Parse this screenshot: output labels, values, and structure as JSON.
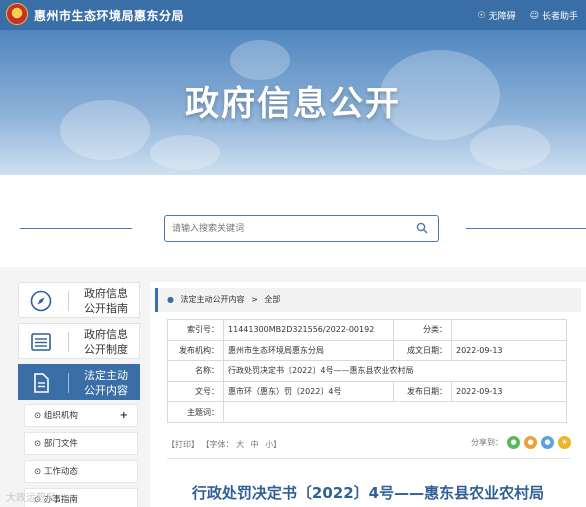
{
  "header": {
    "site_title": "惠州市生态环境局惠东分局",
    "links": [
      {
        "label": "无障碍",
        "icon": "accessibility-icon"
      },
      {
        "label": "长者助手",
        "icon": "elder-assist-icon"
      }
    ]
  },
  "banner": {
    "title": "政府信息公开"
  },
  "search": {
    "placeholder": "请输入搜索关键词"
  },
  "sidebar": {
    "items": [
      {
        "label_line1": "政府信息",
        "label_line2": "公开指南",
        "icon": "compass-icon",
        "active": false
      },
      {
        "label_line1": "政府信息",
        "label_line2": "公开制度",
        "icon": "list-icon",
        "active": false
      },
      {
        "label_line1": "法定主动",
        "label_line2": "公开内容",
        "icon": "document-icon",
        "active": true
      }
    ],
    "subitems": [
      {
        "label": "组织机构",
        "expandable": true,
        "expand_symbol": "+"
      },
      {
        "label": "部门文件",
        "expandable": false
      },
      {
        "label": "工作动态",
        "expandable": false
      },
      {
        "label": "办事指南",
        "expandable": false
      }
    ]
  },
  "breadcrumb": {
    "items": [
      "法定主动公开内容",
      "全部"
    ],
    "separator": ">"
  },
  "meta": {
    "index_label": "索引号：",
    "index_value": "11441300MB2D321556/2022-00192",
    "category_label": "分类：",
    "category_value": "",
    "publisher_label": "发布机构：",
    "publisher_value": "惠州市生态环境局惠东分局",
    "date_label": "成文日期：",
    "date_value": "2022-09-13",
    "name_label": "名称：",
    "name_value": "行政处罚决定书〔2022〕4号——惠东县农业农村局",
    "docno_label": "文号：",
    "docno_value": "惠市环（惠东）罚〔2022〕4号",
    "pubdate_label": "发布日期：",
    "pubdate_value": "2022-09-13",
    "keywords_label": "主题词：",
    "keywords_value": ""
  },
  "tools": {
    "print": "【打印】",
    "font_label": "【字体：",
    "font_large": "大",
    "font_medium": "中",
    "font_small": "小】",
    "share_label": "分享到："
  },
  "document": {
    "title": "行政处罚决定书〔2022〕4号——惠东县农业农村局"
  },
  "watermark": "大政运营局",
  "colors": {
    "primary": "#3a6ea6",
    "title_blue": "#2f5f97",
    "wechat": "#5bb75b",
    "weibo": "#e8a23a",
    "qq": "#5aa3e0",
    "qzone": "#f0b429"
  }
}
